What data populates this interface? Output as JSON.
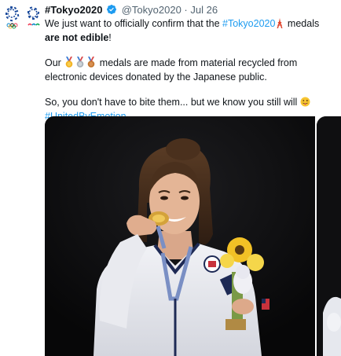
{
  "tweet": {
    "account_name": "#Tokyo2020",
    "handle": "@Tokyo2020",
    "separator": "·",
    "date": "Jul 26",
    "line1_a": "We just want to officially confirm that the ",
    "line1_tag": "#Tokyo2020",
    "line1_c": " medals ",
    "line1_bold": "are not edible",
    "line1_end": "!",
    "line2_a": "Our ",
    "line2_b": " medals are made from material recycled from electronic devices donated by the Japanese public.",
    "line3": "So, you don't have to bite them... but we know you still will ",
    "hashtag": "#UnitedByEmotion"
  },
  "icons": [
    "olympic-paralympic-emblems",
    "verified-badge-icon",
    "tokyo-tower-emoji",
    "gold-medal-emoji",
    "silver-medal-emoji",
    "bronze-medal-emoji",
    "tongue-out-face-emoji"
  ],
  "colors": {
    "link": "#1d9bf0",
    "verified": "#1d9bf0",
    "text": "#0f1419",
    "muted": "#536471"
  }
}
